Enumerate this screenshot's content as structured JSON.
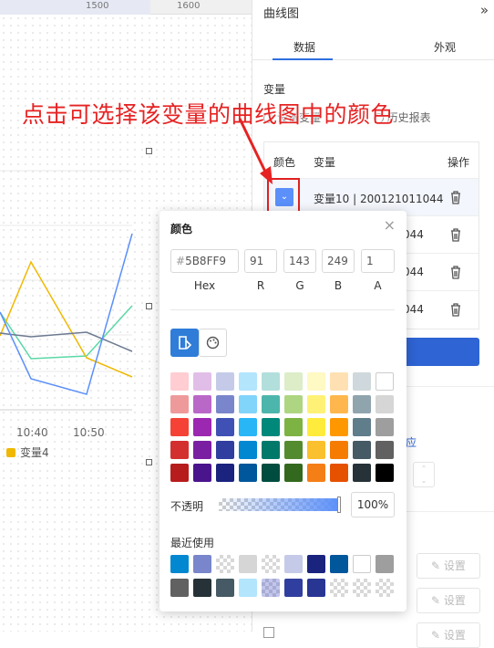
{
  "ruler": {
    "ticks": [
      "1500",
      "1600"
    ]
  },
  "chart": {
    "x_ticks": [
      "10:40",
      "10:50"
    ],
    "legend_label": "变量4",
    "legend_color": "#f0b800"
  },
  "panel": {
    "title": "曲线图",
    "collapse_icon": "double-chevron-right-icon",
    "tabs": [
      {
        "label": "数据",
        "active": true
      },
      {
        "label": "外观",
        "active": false
      }
    ],
    "section_label": "变量",
    "radio_options": [
      "设备变量",
      "历史报表"
    ],
    "table": {
      "headers": [
        "颜色",
        "变量",
        "操作"
      ],
      "rows": [
        {
          "name": "变量10 | 200121011044",
          "color": "#5b8ff9"
        },
        {
          "name": "044"
        },
        {
          "name": "044"
        },
        {
          "name": "044"
        }
      ]
    },
    "partial_text": "应",
    "set_buttons": [
      "设置",
      "设置",
      "设置"
    ]
  },
  "annotation": "点击可选择该变量的曲线图中的颜色",
  "picker": {
    "title": "颜色",
    "close_icon": "close-icon",
    "hex_prefix": "#",
    "hex": "5B8FF9",
    "r": "91",
    "g": "143",
    "b": "249",
    "a": "1",
    "labels": [
      "Hex",
      "R",
      "G",
      "B",
      "A"
    ],
    "opacity_label": "不透明",
    "opacity_value": "100%",
    "recent_label": "最近使用",
    "palette": [
      "#ffcdd2",
      "#e1bee7",
      "#c5cae9",
      "#b3e5fc",
      "#b2dfdb",
      "#dcedc8",
      "#fff9c4",
      "#ffe0b2",
      "#cfd8dc",
      "#ffffff",
      "#ef9a9a",
      "#ba68c8",
      "#7986cb",
      "#81d4fa",
      "#4db6ac",
      "#aed581",
      "#fff176",
      "#ffb74d",
      "#90a4ae",
      "#d6d6d6",
      "#f44336",
      "#9c27b0",
      "#3f51b5",
      "#29b6f6",
      "#00897b",
      "#7cb342",
      "#ffeb3b",
      "#ff9800",
      "#607d8b",
      "#9e9e9e",
      "#d32f2f",
      "#7b1fa2",
      "#303f9f",
      "#0288d1",
      "#00796b",
      "#558b2f",
      "#fbc02d",
      "#f57c00",
      "#455a64",
      "#616161",
      "#b71c1c",
      "#4a148c",
      "#1a237e",
      "#01579b",
      "#004d40",
      "#33691e",
      "#f57f17",
      "#e65100",
      "#263238",
      "#000000"
    ],
    "recent": [
      "#0288d1",
      "#7986cb",
      "checker",
      "#d6d6d6",
      "checker",
      "#c5cae9",
      "#1a237e",
      "#01579b",
      "#ffffff",
      "#9e9e9e",
      "#616161",
      "#263238",
      "#455a64",
      "#b3e5fc",
      "checker-blue",
      "#303f9f",
      "#283593",
      "checker",
      "checker",
      "checker"
    ]
  }
}
